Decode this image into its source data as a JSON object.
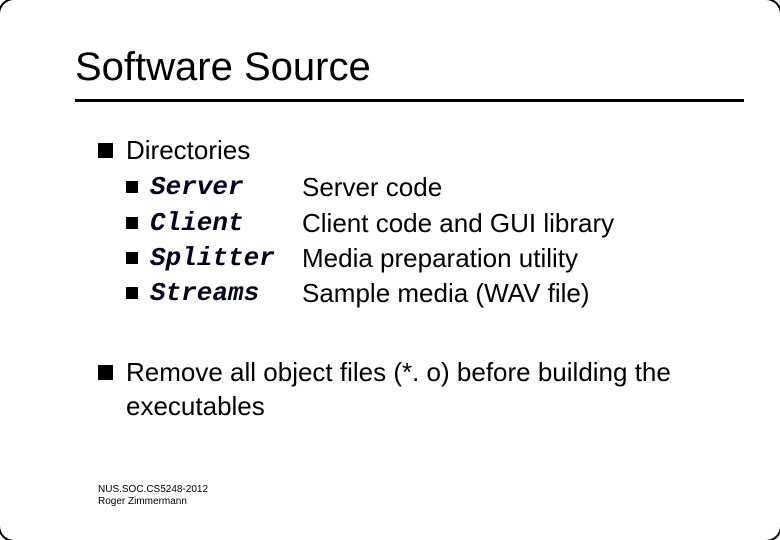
{
  "title": "Software Source",
  "bullets": {
    "directories_label": "Directories",
    "items": [
      {
        "name": "Server",
        "desc": "Server code"
      },
      {
        "name": "Client",
        "desc": "Client code and GUI library"
      },
      {
        "name": "Splitter",
        "desc": "Media preparation utility"
      },
      {
        "name": "Streams",
        "desc": "Sample media (WAV file)"
      }
    ],
    "remove_note": "Remove all object files (*. o) before building the executables"
  },
  "footer": {
    "line1": "NUS.SOC.CS5248-2012",
    "line2": "Roger Zimmermann"
  }
}
